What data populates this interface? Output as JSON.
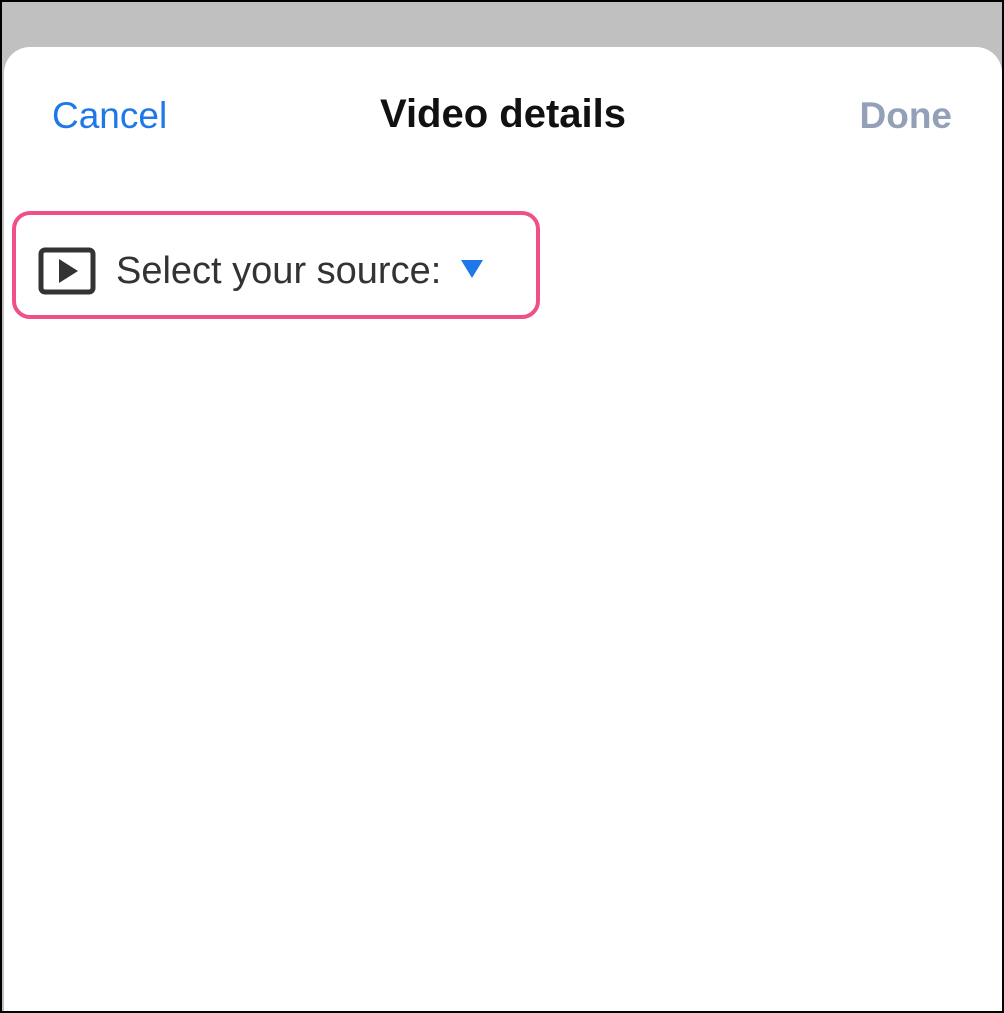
{
  "header": {
    "cancel_label": "Cancel",
    "title": "Video details",
    "done_label": "Done"
  },
  "source_selector": {
    "label": "Select your source:",
    "icon": "video-play-icon",
    "arrow_icon": "triangle-down-icon"
  },
  "colors": {
    "accent": "#1F78E8",
    "done_disabled": "#94A0B7",
    "highlight": "#F0508A",
    "backdrop": "#BFC0BF"
  }
}
